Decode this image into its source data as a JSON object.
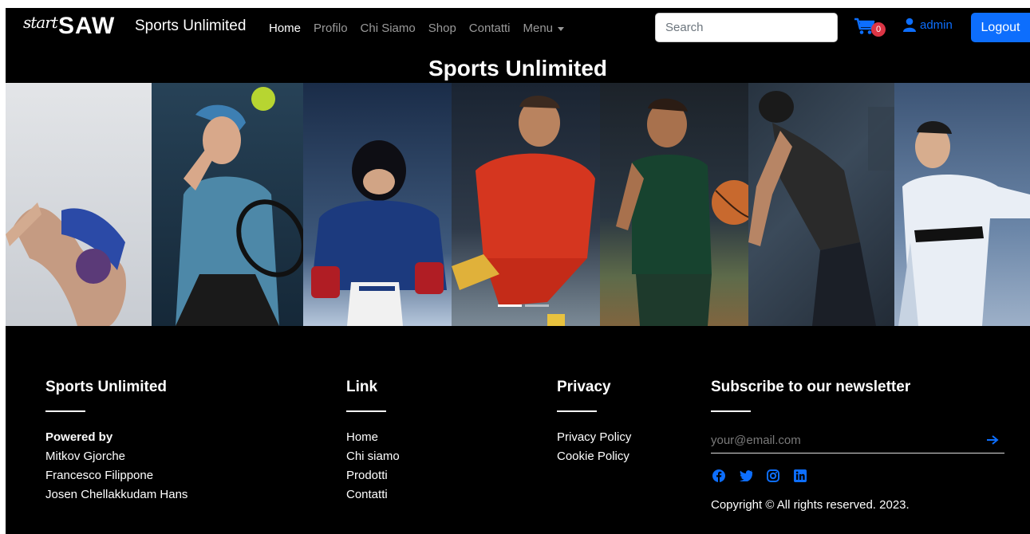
{
  "brand": {
    "script": "start",
    "main": "SAW",
    "name": "Sports Unlimited"
  },
  "nav": {
    "items": [
      {
        "label": "Home",
        "active": true
      },
      {
        "label": "Profilo"
      },
      {
        "label": "Chi Siamo"
      },
      {
        "label": "Shop"
      },
      {
        "label": "Contatti"
      },
      {
        "label": "Menu"
      }
    ]
  },
  "search": {
    "placeholder": "Search",
    "value": ""
  },
  "cart": {
    "count": "0",
    "icon": "cart-icon"
  },
  "user": {
    "name": "admin",
    "icon": "user-icon"
  },
  "logout_label": "Logout",
  "hero": {
    "title": "Sports Unlimited",
    "panels": [
      "gymnastics",
      "tennis",
      "hockey",
      "soccer",
      "basketball",
      "fitness",
      "karate"
    ],
    "indicators": [
      {
        "active": true
      },
      {
        "active": false
      }
    ]
  },
  "footer": {
    "col1": {
      "title": "Sports Unlimited",
      "powered_label": "Powered by",
      "authors": [
        "Mitkov Gjorche",
        "Francesco Filippone",
        "Josen Chellakkudam Hans"
      ]
    },
    "col2": {
      "title": "Link",
      "links": [
        "Home",
        "Chi siamo",
        "Prodotti",
        "Contatti"
      ]
    },
    "col3": {
      "title": "Privacy",
      "links": [
        "Privacy Policy",
        "Cookie Policy"
      ]
    },
    "col4": {
      "title": "Subscribe to our newsletter",
      "email_placeholder": "your@email.com",
      "submit_icon": "arrow-right-icon",
      "socials": [
        "facebook-icon",
        "twitter-icon",
        "instagram-icon",
        "linkedin-icon"
      ],
      "copyright": "Copyright © All rights reserved. 2023."
    }
  },
  "colors": {
    "accent": "#0d6efd",
    "badge": "#dc3545",
    "background": "#000000"
  }
}
